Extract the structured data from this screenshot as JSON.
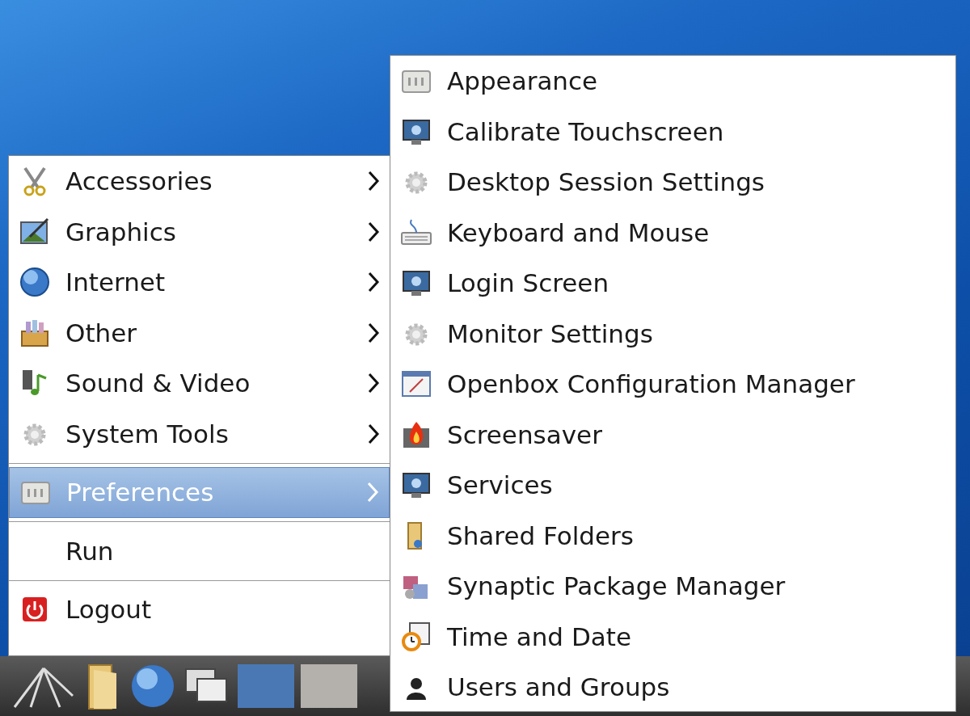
{
  "main_menu": {
    "items": [
      {
        "kind": "submenu",
        "label": "Accessories",
        "selected": false
      },
      {
        "kind": "submenu",
        "label": "Graphics",
        "selected": false
      },
      {
        "kind": "submenu",
        "label": "Internet",
        "selected": false
      },
      {
        "kind": "submenu",
        "label": "Other",
        "selected": false
      },
      {
        "kind": "submenu",
        "label": "Sound & Video",
        "selected": false
      },
      {
        "kind": "submenu",
        "label": "System Tools",
        "selected": false
      },
      {
        "kind": "separator"
      },
      {
        "kind": "submenu",
        "label": "Preferences",
        "selected": true
      },
      {
        "kind": "separator"
      },
      {
        "kind": "action",
        "label": "Run",
        "selected": false
      },
      {
        "kind": "separator"
      },
      {
        "kind": "action",
        "label": "Logout",
        "selected": false
      }
    ]
  },
  "preferences_menu": {
    "items": [
      {
        "label": "Appearance"
      },
      {
        "label": "Calibrate Touchscreen"
      },
      {
        "label": "Desktop Session Settings"
      },
      {
        "label": "Keyboard and Mouse"
      },
      {
        "label": "Login Screen"
      },
      {
        "label": "Monitor Settings"
      },
      {
        "label": "Openbox Configuration Manager"
      },
      {
        "label": "Screensaver"
      },
      {
        "label": "Services"
      },
      {
        "label": "Shared Folders"
      },
      {
        "label": "Synaptic Package Manager"
      },
      {
        "label": "Time and Date"
      },
      {
        "label": "Users and Groups"
      }
    ]
  }
}
